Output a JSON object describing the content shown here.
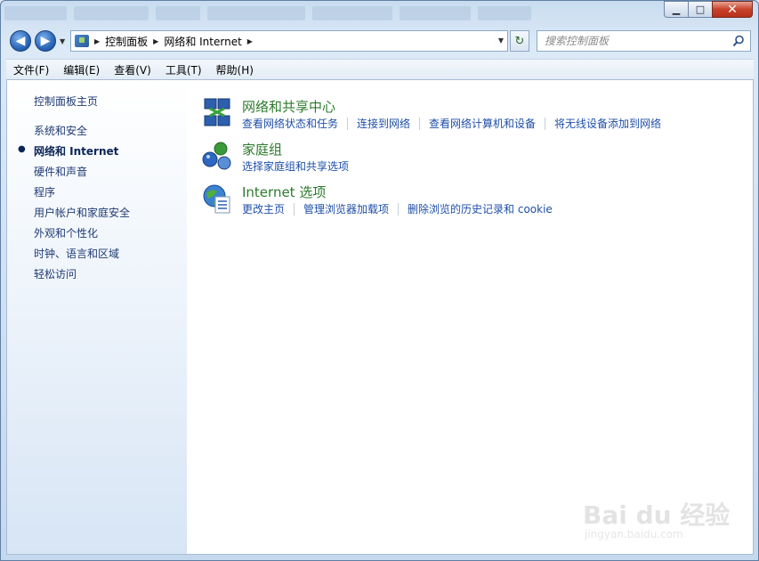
{
  "window": {
    "minimize": "▁",
    "maximize": "□",
    "close": "✕"
  },
  "navigation": {
    "back_icon": "◀",
    "forward_icon": "▶",
    "recent_icon": "▼",
    "breadcrumb": [
      "控制面板",
      "网络和 Internet"
    ],
    "refresh_icon": "↻"
  },
  "search": {
    "placeholder": "搜索控制面板"
  },
  "menu": [
    "文件(F)",
    "编辑(E)",
    "查看(V)",
    "工具(T)",
    "帮助(H)"
  ],
  "sidebar": {
    "home": "控制面板主页",
    "items": [
      {
        "label": "系统和安全",
        "active": false
      },
      {
        "label": "网络和 Internet",
        "active": true
      },
      {
        "label": "硬件和声音",
        "active": false
      },
      {
        "label": "程序",
        "active": false
      },
      {
        "label": "用户帐户和家庭安全",
        "active": false
      },
      {
        "label": "外观和个性化",
        "active": false
      },
      {
        "label": "时钟、语言和区域",
        "active": false
      },
      {
        "label": "轻松访问",
        "active": false
      }
    ],
    "bullet": "●"
  },
  "categories": [
    {
      "title": "网络和共享中心",
      "icon": "network-sharing-center-icon",
      "links": [
        "查看网络状态和任务",
        "连接到网络",
        "查看网络计算机和设备",
        "将无线设备添加到网络"
      ]
    },
    {
      "title": "家庭组",
      "icon": "homegroup-icon",
      "links": [
        "选择家庭组和共享选项"
      ]
    },
    {
      "title": "Internet 选项",
      "icon": "internet-options-icon",
      "links": [
        "更改主页",
        "管理浏览器加载项",
        "删除浏览的历史记录和 cookie"
      ]
    }
  ],
  "watermark": {
    "brand": "Bai du 经验",
    "url": "jingyan.baidu.com"
  }
}
